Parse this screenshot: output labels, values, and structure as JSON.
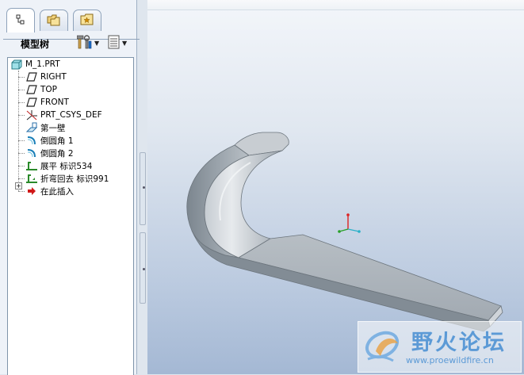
{
  "tree_panel": {
    "title": "模型树",
    "tabs": [
      {
        "name": "model-tree-icon"
      },
      {
        "name": "folder-browser-icon"
      },
      {
        "name": "favorites-icon"
      }
    ],
    "items": [
      {
        "label": "M_1.PRT",
        "icon": "part-icon"
      },
      {
        "label": "RIGHT",
        "icon": "datum-plane-icon"
      },
      {
        "label": "TOP",
        "icon": "datum-plane-icon"
      },
      {
        "label": "FRONT",
        "icon": "datum-plane-icon"
      },
      {
        "label": "PRT_CSYS_DEF",
        "icon": "csys-icon"
      },
      {
        "label": "第一壁",
        "icon": "first-wall-icon"
      },
      {
        "label": "倒圆角 1",
        "icon": "round-icon"
      },
      {
        "label": "倒圆角 2",
        "icon": "round-icon"
      },
      {
        "label": "展平 标识534",
        "icon": "unbend-icon"
      },
      {
        "label": "折弯回去 标识991",
        "icon": "bend-back-icon"
      },
      {
        "label": "在此插入",
        "icon": "insert-here-icon"
      }
    ]
  },
  "watermark": {
    "title": "野火论坛",
    "url": "www.proewildfire.cn"
  },
  "colors": {
    "panel_bg": "#eef2f8",
    "viewport_top": "#f3f6fa",
    "viewport_bottom": "#a4b8d4",
    "part_gray": "#a8b0b8",
    "insert_arrow": "#d01818",
    "watermark": "#5c9ad6"
  }
}
